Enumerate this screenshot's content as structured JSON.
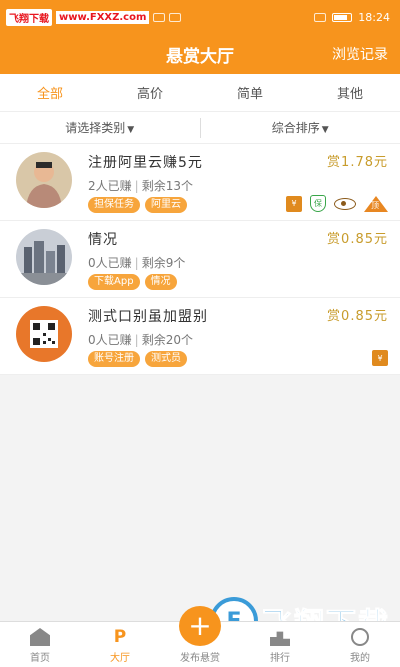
{
  "status_bar": {
    "watermark_left": "飞翔下载",
    "watermark_url": "www.FXXZ.com",
    "time": "18:24"
  },
  "header": {
    "title": "悬赏大厅",
    "right_link": "浏览记录"
  },
  "tabs": [
    {
      "label": "全部",
      "active": true
    },
    {
      "label": "高价",
      "active": false
    },
    {
      "label": "简单",
      "active": false
    },
    {
      "label": "其他",
      "active": false
    }
  ],
  "filters": {
    "category": "请选择类别",
    "sort": "综合排序"
  },
  "tasks": [
    {
      "title": "注册阿里云赚5元",
      "reward": "赏1.78元",
      "earned": "2人已赚",
      "remaining": "剩余13个",
      "tags": [
        "担保任务",
        "阿里云"
      ],
      "badges": [
        "guarantee-icon",
        "protect-icon",
        "eye-icon",
        "top-icon"
      ],
      "badge_text": {
        "guarantee": "¥",
        "protect": "保",
        "top": "顶"
      }
    },
    {
      "title": "情况",
      "reward": "赏0.85元",
      "earned": "0人已赚",
      "remaining": "剩余9个",
      "tags": [
        "下载App",
        "情况"
      ],
      "badges": []
    },
    {
      "title": "测式口别虽加盟别",
      "reward": "赏0.85元",
      "earned": "0人已赚",
      "remaining": "剩余20个",
      "tags": [
        "账号注册",
        "测式员"
      ],
      "badges": [
        "guarantee-icon"
      ],
      "badge_text": {
        "guarantee": "¥"
      }
    }
  ],
  "tabbar": [
    {
      "label": "首页",
      "icon": "home-icon",
      "active": false
    },
    {
      "label": "大厅",
      "icon": "lobby-icon",
      "active": true
    },
    {
      "label": "发布悬赏",
      "icon": "plus-icon",
      "active": false
    },
    {
      "label": "排行",
      "icon": "rank-icon",
      "active": false
    },
    {
      "label": "我的",
      "icon": "user-icon",
      "active": false
    }
  ],
  "lobby_icon_glyph": "P",
  "publish_glyph": "+",
  "watermark_br": "飞翔下载",
  "colors": {
    "accent": "#f7941d",
    "reward": "#c89c2c",
    "tag": "#f7a53c"
  }
}
